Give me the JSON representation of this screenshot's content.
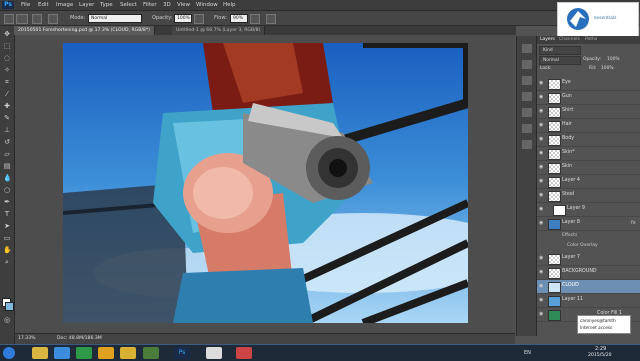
{
  "app": {
    "logo": "Ps"
  },
  "menu": [
    "File",
    "Edit",
    "Image",
    "Layer",
    "Type",
    "Select",
    "Filter",
    "3D",
    "View",
    "Window",
    "Help"
  ],
  "options_bar": {
    "mode_label": "Mode:",
    "mode_value": "Normal",
    "opacity_label": "Opacity:",
    "opacity_value": "100%",
    "flow_label": "Flow:",
    "flow_value": "90%"
  },
  "overlay_logo": {
    "text": "essentials"
  },
  "doc_tabs": [
    {
      "label": "20150501 Foreshortening.psd @ 17.3% (CLOUD, RGB/8*)",
      "active": true
    },
    {
      "label": "Untitled-1 @ 66.7% (Layer 3, RGB/8)",
      "active": false
    }
  ],
  "status": {
    "zoom": "17.33%",
    "doc": "Doc: 48.8M/186.3M"
  },
  "layers_panel": {
    "tabs": [
      "Layers",
      "Channels",
      "Paths"
    ],
    "kind_label": "Kind",
    "blend_mode": "Normal",
    "opacity_label": "Opacity:",
    "opacity_value": "100%",
    "lock_label": "Lock:",
    "fill_label": "Fill:",
    "fill_value": "100%",
    "layers": [
      "Eye",
      "Gun",
      "Shirt",
      "Hair",
      "Body",
      "Skin*",
      "Skin",
      "Layer 4",
      "Steel",
      "Layer 9",
      "Layer 8",
      "Effects",
      "Color Overlay",
      "Layer 7",
      "BACKGROUND",
      "CLOUD",
      "Layer 11",
      "Color Fill 1"
    ],
    "selected_layer": "CLOUD"
  },
  "tooltip": {
    "line1": "caronyes@tamth",
    "line2": "Internet access"
  },
  "taskbar": {
    "lang": "EN",
    "time": "2:29",
    "date": "2015/5/20"
  },
  "colors": {
    "accent": "#6d8fb3",
    "panel": "#535353",
    "taskbar": "#1f2a38"
  }
}
